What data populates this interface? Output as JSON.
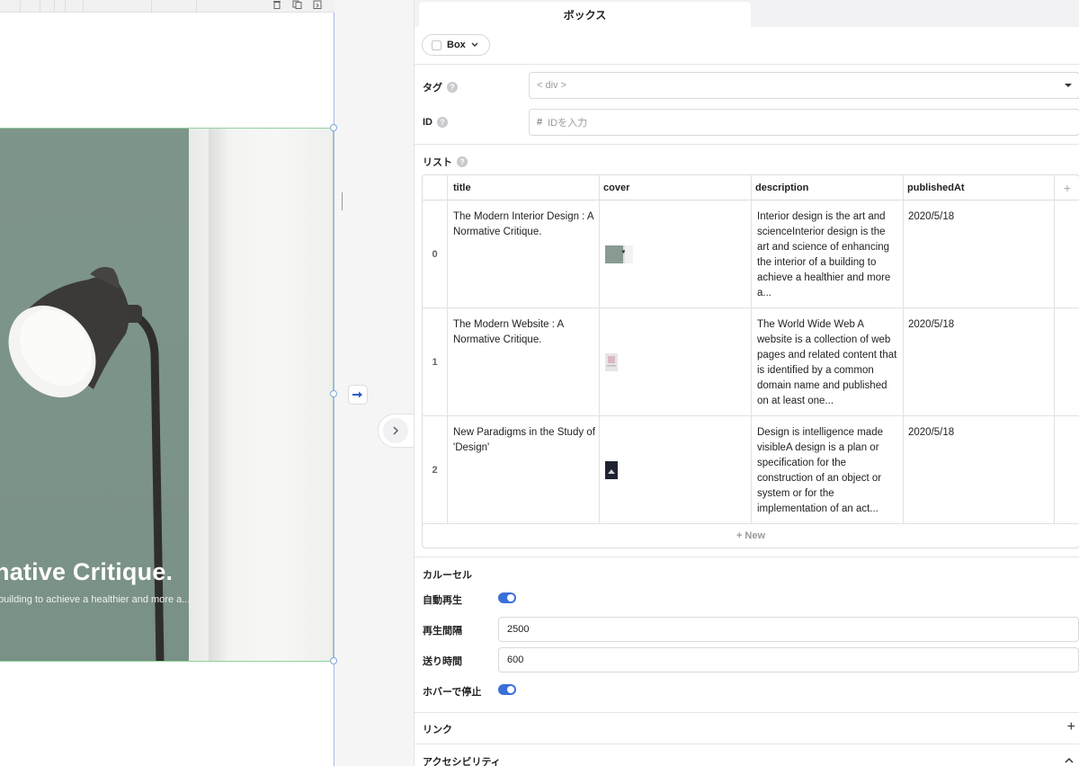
{
  "canvas": {
    "hero_title": "native Critique.",
    "hero_subtitle": "building to achieve a healthier and more a..."
  },
  "panel": {
    "tab": "ボックス",
    "element_type": "Box",
    "tag": {
      "label": "タグ",
      "help": "?",
      "value": "< div >"
    },
    "id": {
      "label": "ID",
      "help": "?",
      "prefix": "#",
      "placeholder": "IDを入力"
    },
    "list": {
      "label": "リスト",
      "help": "?",
      "columns": [
        "title",
        "cover",
        "description",
        "publishedAt"
      ],
      "add_column": "+",
      "rows": [
        {
          "index": "0",
          "title": "The Modern Interior Design : A Normative Critique.",
          "description": "Interior design is the art and scienceInterior design is the art and science of enhancing the interior of a building to achieve a healthier and more a...",
          "publishedAt": "2020/5/18"
        },
        {
          "index": "1",
          "title": "The Modern Website : A Normative Critique.",
          "description": "The World Wide Web A website is a collection of web pages and related content that is identified by a common domain name and published on at least one...",
          "publishedAt": "2020/5/18"
        },
        {
          "index": "2",
          "title": "New Paradigms in the Study of 'Design'",
          "description": "Design is intelligence made visibleA design is a plan or specification for the construction of an object or system or for the implementation of an act...",
          "publishedAt": "2020/5/18"
        }
      ],
      "new_row": "+ New"
    },
    "carousel": {
      "title": "カルーセル",
      "autoplay_label": "自動再生",
      "autoplay_on": true,
      "interval_label": "再生間隔",
      "interval_value": "2500",
      "speed_label": "送り時間",
      "speed_value": "600",
      "pause_hover_label": "ホバーで停止",
      "pause_hover_on": true
    },
    "link": {
      "label": "リンク",
      "icon": "+"
    },
    "accessibility": {
      "label": "アクセシビリティ"
    }
  },
  "colors": {
    "accent": "#3b6fd8",
    "selection": "#8ed39d",
    "frame": "#a9b8e4"
  }
}
